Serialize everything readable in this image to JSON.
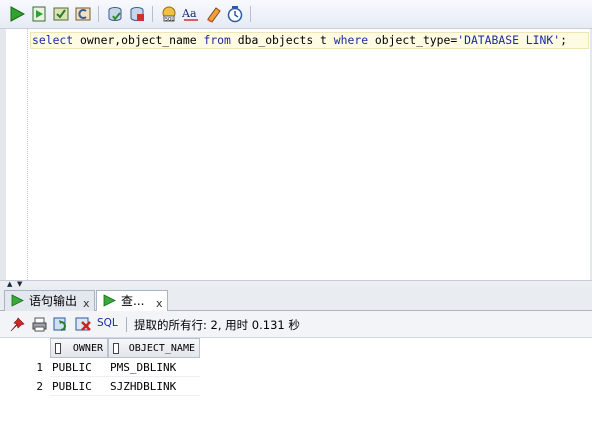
{
  "toolbar": {
    "buttons": [
      {
        "name": "run-statement-icon",
        "color": "#2e9a2e"
      },
      {
        "name": "run-script-icon",
        "color": "#3a7a3a"
      },
      {
        "name": "commit-icon",
        "color": "#6a7f3a"
      },
      {
        "name": "rollback-icon",
        "color": "#8a6a2a"
      },
      {
        "name": "autotrace-icon",
        "color": "#3a6a9a"
      },
      {
        "name": "explain-plan-icon",
        "color": "#b03030"
      },
      {
        "name": "sql-tuning-icon",
        "color": "#c08020"
      },
      {
        "name": "format-case-icon",
        "color": "#203a8a"
      },
      {
        "name": "eraser-icon",
        "color": "#d08030"
      },
      {
        "name": "history-icon",
        "color": "#2a5aa0"
      }
    ]
  },
  "editor": {
    "sql": {
      "kw_select": "select",
      "cols": " owner,object_name ",
      "kw_from": "from",
      "table": " dba_objects t ",
      "kw_where": "where",
      "cond": " object_type=",
      "literal": "'DATABASE LINK'",
      "end": ";"
    }
  },
  "tabs": [
    {
      "label": "语句输出",
      "close": "x"
    },
    {
      "label": "查...",
      "close": "x"
    }
  ],
  "result_toolbar": {
    "sql_label": "SQL",
    "fetch_info": "提取的所有行: 2, 用时 0.131 秒"
  },
  "grid": {
    "columns": [
      "OWNER",
      "OBJECT_NAME"
    ],
    "rows": [
      {
        "num": "1",
        "owner": "PUBLIC",
        "object_name": "PMS_DBLINK"
      },
      {
        "num": "2",
        "owner": "PUBLIC",
        "object_name": "SJZHDBLINK"
      }
    ]
  },
  "colors": {
    "keyword": "#1a2ba0",
    "current_line": "#fffbe3"
  }
}
